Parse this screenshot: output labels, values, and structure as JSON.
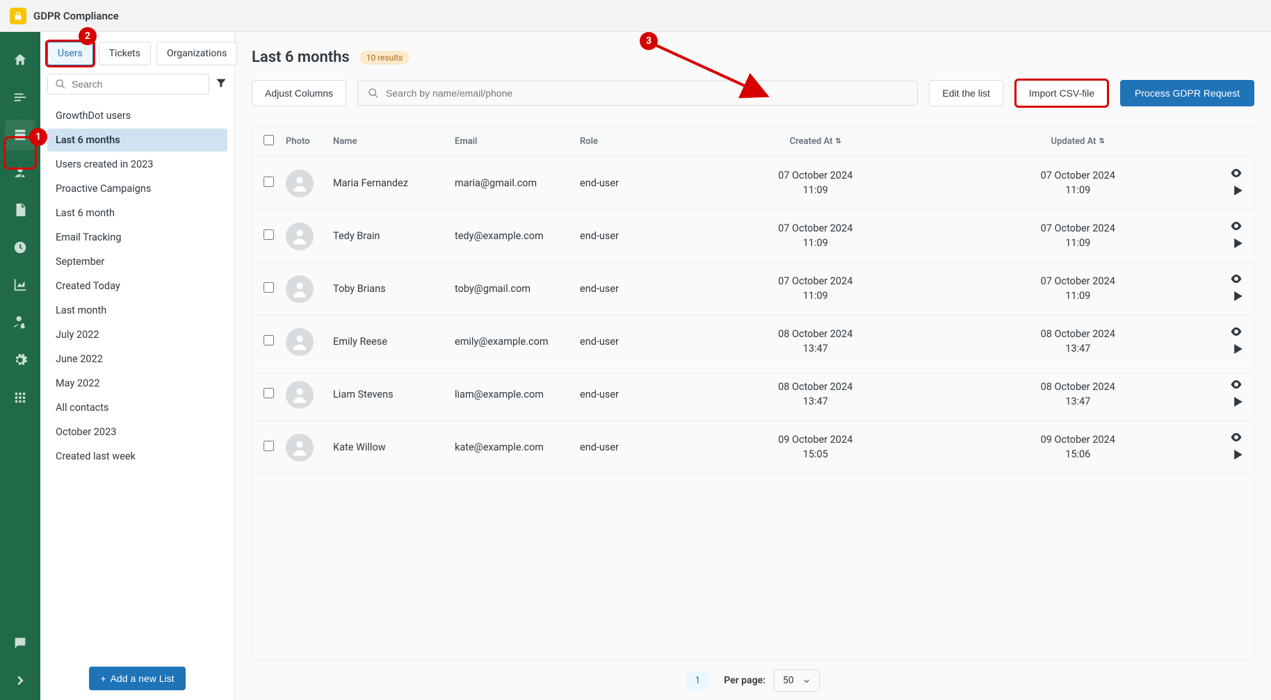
{
  "topbar": {
    "title": "GDPR Compliance"
  },
  "annotations": {
    "one": "1",
    "two": "2",
    "three": "3"
  },
  "tabs": {
    "users": "Users",
    "tickets": "Tickets",
    "organizations": "Organizations"
  },
  "sidebar": {
    "search_placeholder": "Search",
    "items": [
      "GrowthDot users",
      "Last 6 months",
      "Users created in 2023",
      "Proactive Campaigns",
      "Last 6 month",
      "Email Tracking",
      "September",
      "Created Today",
      "Last month",
      "July 2022",
      "June 2022",
      "May 2022",
      "All contacts",
      "October 2023",
      "Created last week"
    ],
    "add_list_label": "Add a new List"
  },
  "content": {
    "title": "Last 6 months",
    "results_label": "10 results",
    "adjust_columns": "Adjust Columns",
    "search_placeholder": "Search by name/email/phone",
    "edit_list": "Edit the list",
    "import_csv": "Import CSV-file",
    "process_gdpr": "Process GDPR Request"
  },
  "table": {
    "headers": {
      "photo": "Photo",
      "name": "Name",
      "email": "Email",
      "role": "Role",
      "created": "Created At",
      "updated": "Updated At"
    },
    "rows": [
      {
        "name": "Maria Fernandez",
        "email": "maria@gmail.com",
        "role": "end-user",
        "created_date": "07 October 2024",
        "created_time": "11:09",
        "updated_date": "07 October 2024",
        "updated_time": "11:09"
      },
      {
        "name": "Tedy Brain",
        "email": "tedy@example.com",
        "role": "end-user",
        "created_date": "07 October 2024",
        "created_time": "11:09",
        "updated_date": "07 October 2024",
        "updated_time": "11:09"
      },
      {
        "name": "Toby Brians",
        "email": "toby@gmail.com",
        "role": "end-user",
        "created_date": "07 October 2024",
        "created_time": "11:09",
        "updated_date": "07 October 2024",
        "updated_time": "11:09"
      },
      {
        "name": "Emily Reese",
        "email": "emily@example.com",
        "role": "end-user",
        "created_date": "08 October 2024",
        "created_time": "13:47",
        "updated_date": "08 October 2024",
        "updated_time": "13:47"
      },
      {
        "name": "Liam Stevens",
        "email": "liam@example.com",
        "role": "end-user",
        "created_date": "08 October 2024",
        "created_time": "13:47",
        "updated_date": "08 October 2024",
        "updated_time": "13:47"
      },
      {
        "name": "Kate Willow",
        "email": "kate@example.com",
        "role": "end-user",
        "created_date": "09 October 2024",
        "created_time": "15:05",
        "updated_date": "09 October 2024",
        "updated_time": "15:06"
      }
    ]
  },
  "pagination": {
    "page": "1",
    "per_page_label": "Per page:",
    "per_page_value": "50"
  }
}
